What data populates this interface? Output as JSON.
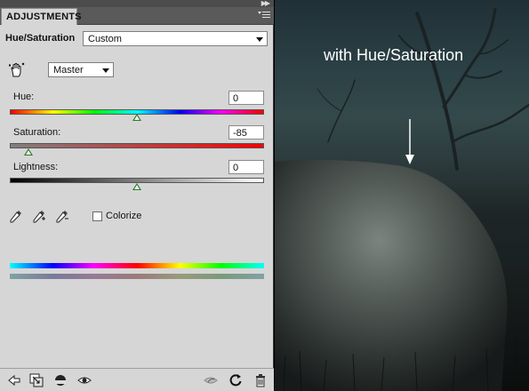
{
  "panel": {
    "tab_label": "ADJUSTMENTS",
    "adjustment_name": "Hue/Saturation",
    "preset_value": "Custom",
    "channel_value": "Master",
    "hue": {
      "label": "Hue:",
      "value": "0",
      "level": 0.5
    },
    "saturation": {
      "label": "Saturation:",
      "value": "-85",
      "level": 0.075
    },
    "lightness": {
      "label": "Lightness:",
      "value": "0",
      "level": 0.5
    },
    "colorize_label": "Colorize",
    "colorize_checked": false
  },
  "icons": {
    "collapse": "double-chevron-right-icon",
    "menu": "panel-menu-icon",
    "targeted_adjust": "hand-scrub-icon",
    "eyedroppers": [
      "eyedropper-icon",
      "eyedropper-plus-icon",
      "eyedropper-minus-icon"
    ],
    "bottom_left": [
      "back-arrow-icon",
      "clip-to-layer-icon",
      "layer-mask-icon",
      "visibility-eye-icon"
    ],
    "bottom_right": [
      "previous-state-icon",
      "reset-icon",
      "trash-icon"
    ]
  },
  "image": {
    "caption": "with Hue/Saturation"
  }
}
